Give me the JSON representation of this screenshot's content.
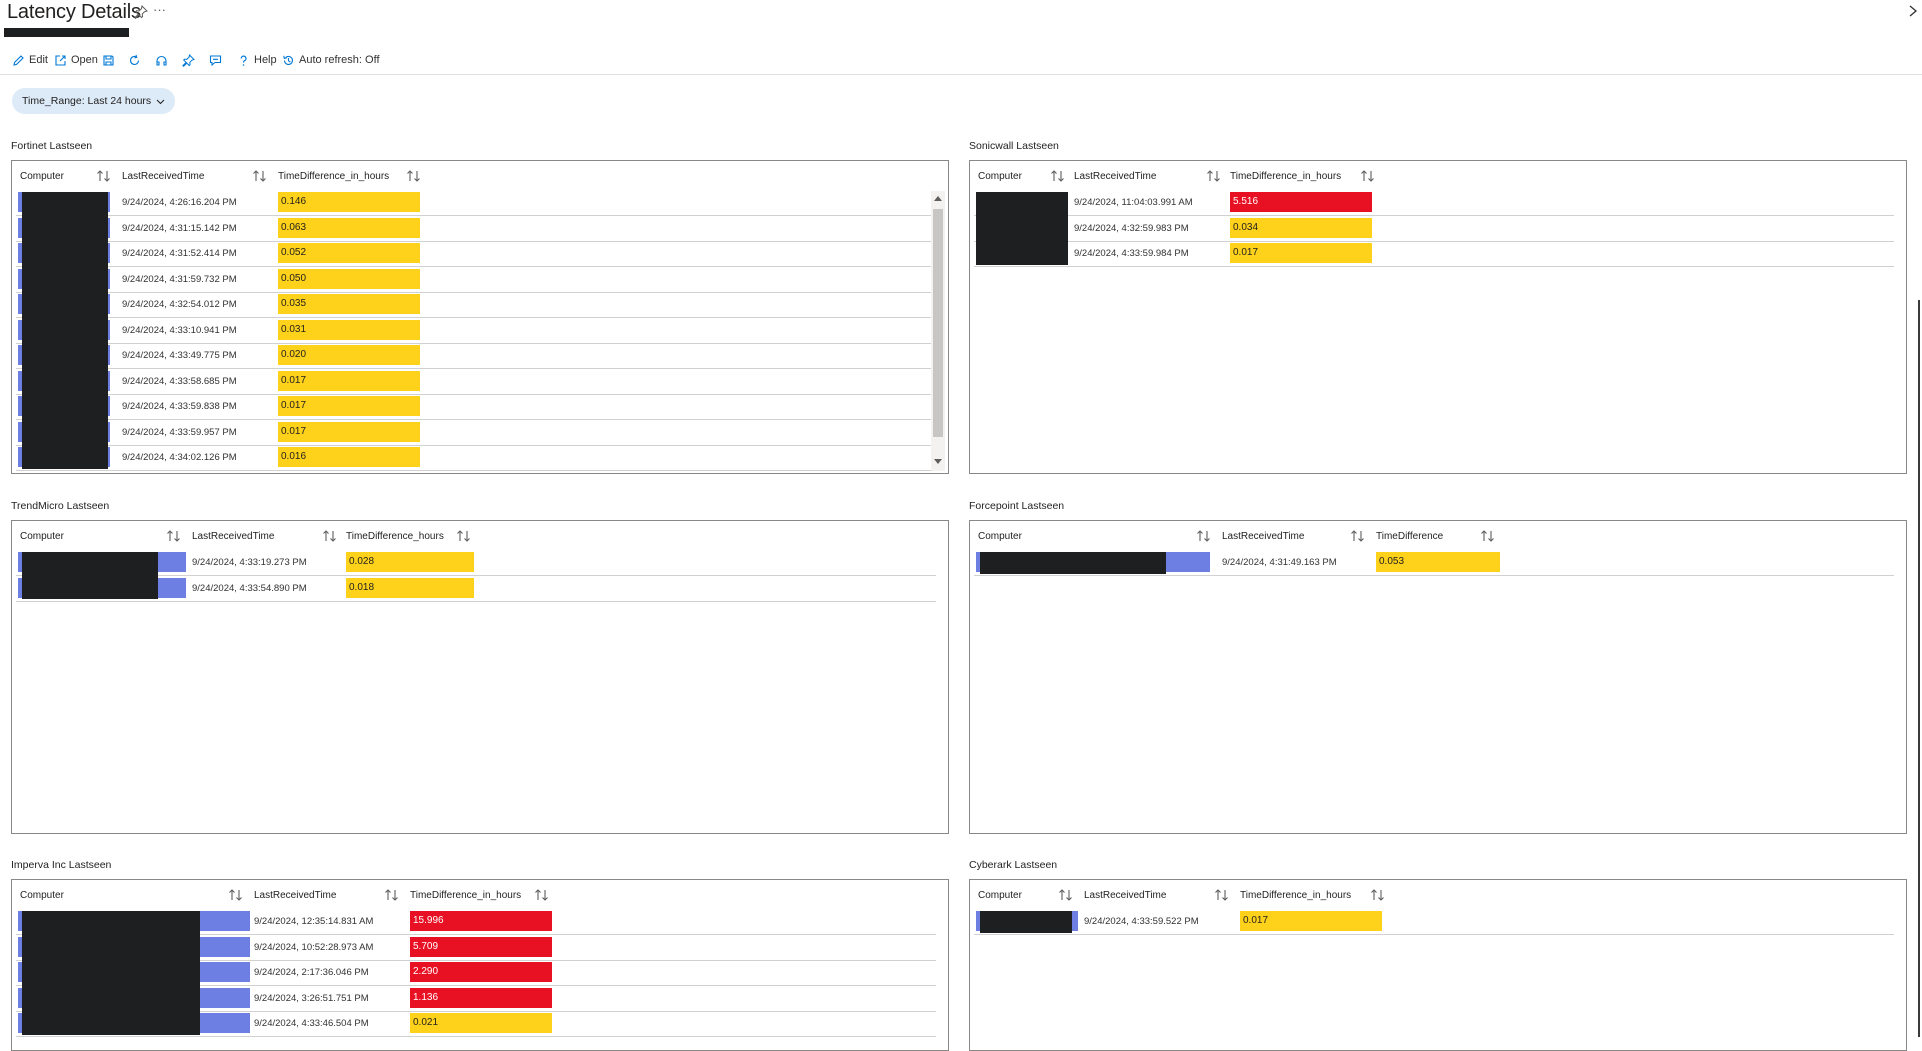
{
  "page": {
    "title": "Latency Details"
  },
  "toolbar": {
    "edit_label": "Edit",
    "open_label": "Open",
    "help_label": "Help",
    "auto_refresh_label": "Auto refresh: Off"
  },
  "param": {
    "label": "Time_Range: Last 24 hours"
  },
  "colors": {
    "high": "#e81123",
    "low": "#fed11b",
    "computer_bar": "#6e7fe3",
    "redaction": "#1d1f21"
  },
  "panels": {
    "fortinet": {
      "title": "Fortinet Lastseen",
      "columns": [
        "Computer",
        "LastReceivedTime",
        "TimeDifference_in_hours"
      ],
      "rows": [
        {
          "time": "9/24/2024, 4:26:16.204 PM",
          "value": "0.146",
          "level": "low"
        },
        {
          "time": "9/24/2024, 4:31:15.142 PM",
          "value": "0.063",
          "level": "low"
        },
        {
          "time": "9/24/2024, 4:31:52.414 PM",
          "value": "0.052",
          "level": "low"
        },
        {
          "time": "9/24/2024, 4:31:59.732 PM",
          "value": "0.050",
          "level": "low"
        },
        {
          "time": "9/24/2024, 4:32:54.012 PM",
          "value": "0.035",
          "level": "low"
        },
        {
          "time": "9/24/2024, 4:33:10.941 PM",
          "value": "0.031",
          "level": "low"
        },
        {
          "time": "9/24/2024, 4:33:49.775 PM",
          "value": "0.020",
          "level": "low"
        },
        {
          "time": "9/24/2024, 4:33:58.685 PM",
          "value": "0.017",
          "level": "low"
        },
        {
          "time": "9/24/2024, 4:33:59.838 PM",
          "value": "0.017",
          "level": "low"
        },
        {
          "time": "9/24/2024, 4:33:59.957 PM",
          "value": "0.017",
          "level": "low"
        },
        {
          "time": "9/24/2024, 4:34:02.126 PM",
          "value": "0.016",
          "level": "low"
        }
      ]
    },
    "sonicwall": {
      "title": "Sonicwall Lastseen",
      "columns": [
        "Computer",
        "LastReceivedTime",
        "TimeDifference_in_hours"
      ],
      "rows": [
        {
          "time": "9/24/2024, 11:04:03.991 AM",
          "value": "5.516",
          "level": "high"
        },
        {
          "time": "9/24/2024, 4:32:59.983 PM",
          "value": "0.034",
          "level": "low"
        },
        {
          "time": "9/24/2024, 4:33:59.984 PM",
          "value": "0.017",
          "level": "low"
        }
      ]
    },
    "trendmicro": {
      "title": "TrendMicro Lastseen",
      "columns": [
        "Computer",
        "LastReceivedTime",
        "TimeDifference_hours"
      ],
      "rows": [
        {
          "time": "9/24/2024, 4:33:19.273 PM",
          "value": "0.028",
          "level": "low"
        },
        {
          "time": "9/24/2024, 4:33:54.890 PM",
          "value": "0.018",
          "level": "low"
        }
      ]
    },
    "forcepoint": {
      "title": "Forcepoint Lastseen",
      "columns": [
        "Computer",
        "LastReceivedTime",
        "TimeDifference"
      ],
      "rows": [
        {
          "time": "9/24/2024, 4:31:49.163 PM",
          "value": "0.053",
          "level": "low"
        }
      ]
    },
    "imperva": {
      "title": "Imperva Inc Lastseen",
      "columns": [
        "Computer",
        "LastReceivedTime",
        "TimeDifference_in_hours"
      ],
      "rows": [
        {
          "time": "9/24/2024, 12:35:14.831 AM",
          "value": "15.996",
          "level": "high"
        },
        {
          "time": "9/24/2024, 10:52:28.973 AM",
          "value": "5.709",
          "level": "high"
        },
        {
          "time": "9/24/2024, 2:17:36.046 PM",
          "value": "2.290",
          "level": "high"
        },
        {
          "time": "9/24/2024, 3:26:51.751 PM",
          "value": "1.136",
          "level": "high"
        },
        {
          "time": "9/24/2024, 4:33:46.504 PM",
          "value": "0.021",
          "level": "low"
        }
      ]
    },
    "cyberark": {
      "title": "Cyberark Lastseen",
      "columns": [
        "Computer",
        "LastReceivedTime",
        "TimeDifference_in_hours"
      ],
      "rows": [
        {
          "time": "9/24/2024, 4:33:59.522 PM",
          "value": "0.017",
          "level": "low"
        }
      ]
    }
  }
}
